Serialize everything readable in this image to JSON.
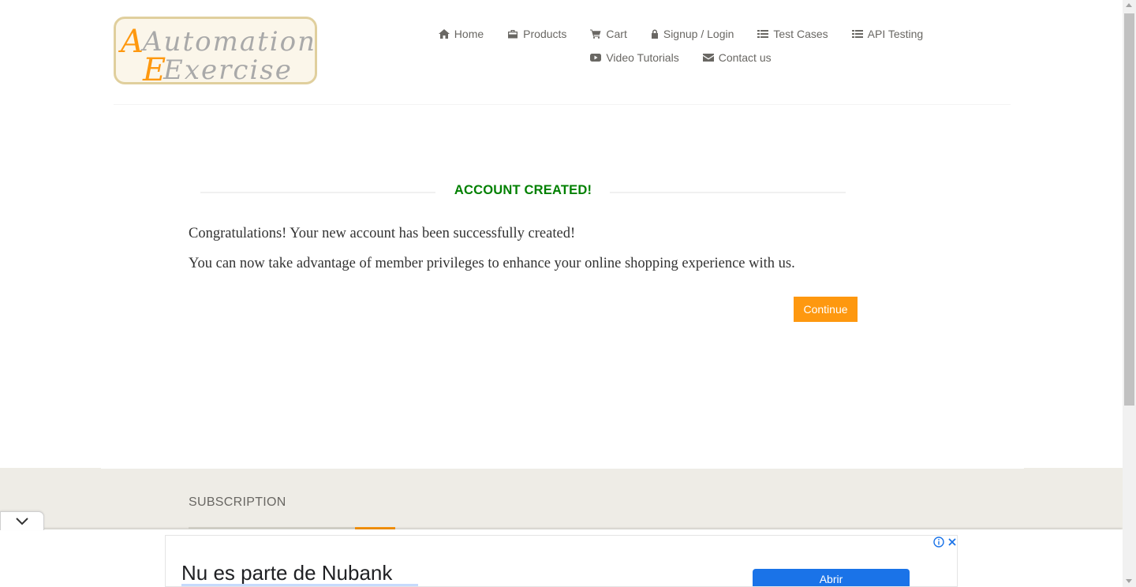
{
  "logo": {
    "line1": "Automation",
    "line2": "Exercise"
  },
  "nav": {
    "items": [
      {
        "label": "Home",
        "icon": "home-icon"
      },
      {
        "label": "Products",
        "icon": "briefcase-icon"
      },
      {
        "label": "Cart",
        "icon": "cart-icon"
      },
      {
        "label": "Signup / Login",
        "icon": "lock-icon"
      },
      {
        "label": "Test Cases",
        "icon": "list-icon"
      },
      {
        "label": "API Testing",
        "icon": "list-icon"
      },
      {
        "label": "Video Tutorials",
        "icon": "youtube-play-icon"
      },
      {
        "label": "Contact us",
        "icon": "envelope-icon"
      }
    ]
  },
  "main": {
    "title": "ACCOUNT CREATED!",
    "message1": "Congratulations! Your new account has been successfully created!",
    "message2": "You can now take advantage of member privileges to enhance your online shopping experience with us.",
    "continue_label": "Continue"
  },
  "footer": {
    "subscription_title": "SUBSCRIPTION"
  },
  "ad": {
    "headline": "Nu es parte de Nubank",
    "button_label": "Abrir"
  },
  "colors": {
    "accent": "#fe980f",
    "success": "#008000",
    "footer_bg": "#eeece6",
    "ad_button": "#1a73e8"
  }
}
